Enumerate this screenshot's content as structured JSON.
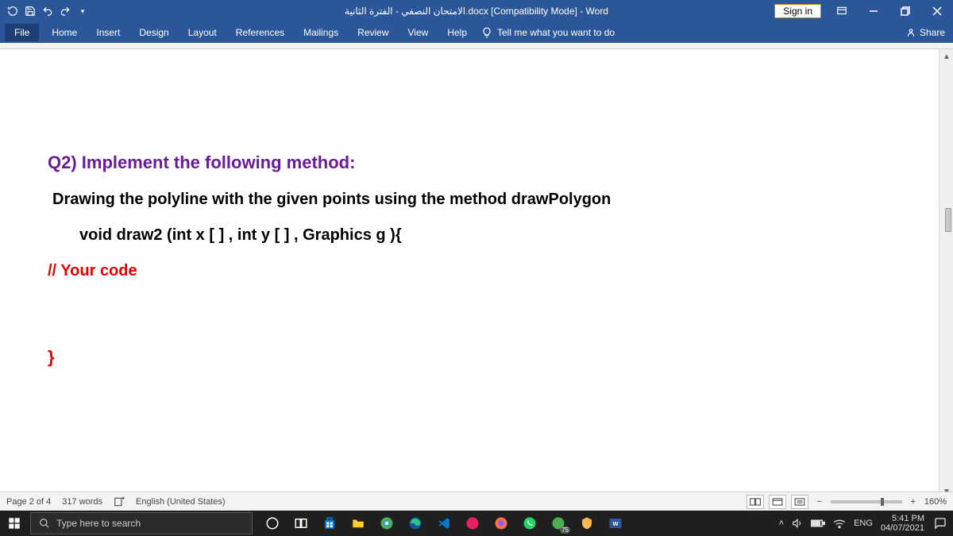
{
  "titlebar": {
    "doc_title": "الامتحان النصفي - الفترة الثانية.docx [Compatibility Mode]  -  Word",
    "signin": "Sign in"
  },
  "ribbon": {
    "tabs": [
      "File",
      "Home",
      "Insert",
      "Design",
      "Layout",
      "References",
      "Mailings",
      "Review",
      "View",
      "Help"
    ],
    "tell_me": "Tell me what you want to do",
    "share": "Share"
  },
  "document": {
    "q2_heading": "Q2) Implement the following method:",
    "description": "Drawing the polyline with the given points using the method drawPolygon",
    "signature": "void draw2 (int x [ ]   , int  y [ ] ,  Graphics g ){",
    "comment": "// Your code",
    "close_brace": "}"
  },
  "statusbar": {
    "page": "Page 2 of 4",
    "words": "317 words",
    "language": "English (United States)",
    "zoom": "160%"
  },
  "taskbar": {
    "search_placeholder": "Type here to search",
    "lang": "ENG",
    "time": "5:41 PM",
    "date": "04/07/2021",
    "battery_badge": "75"
  }
}
